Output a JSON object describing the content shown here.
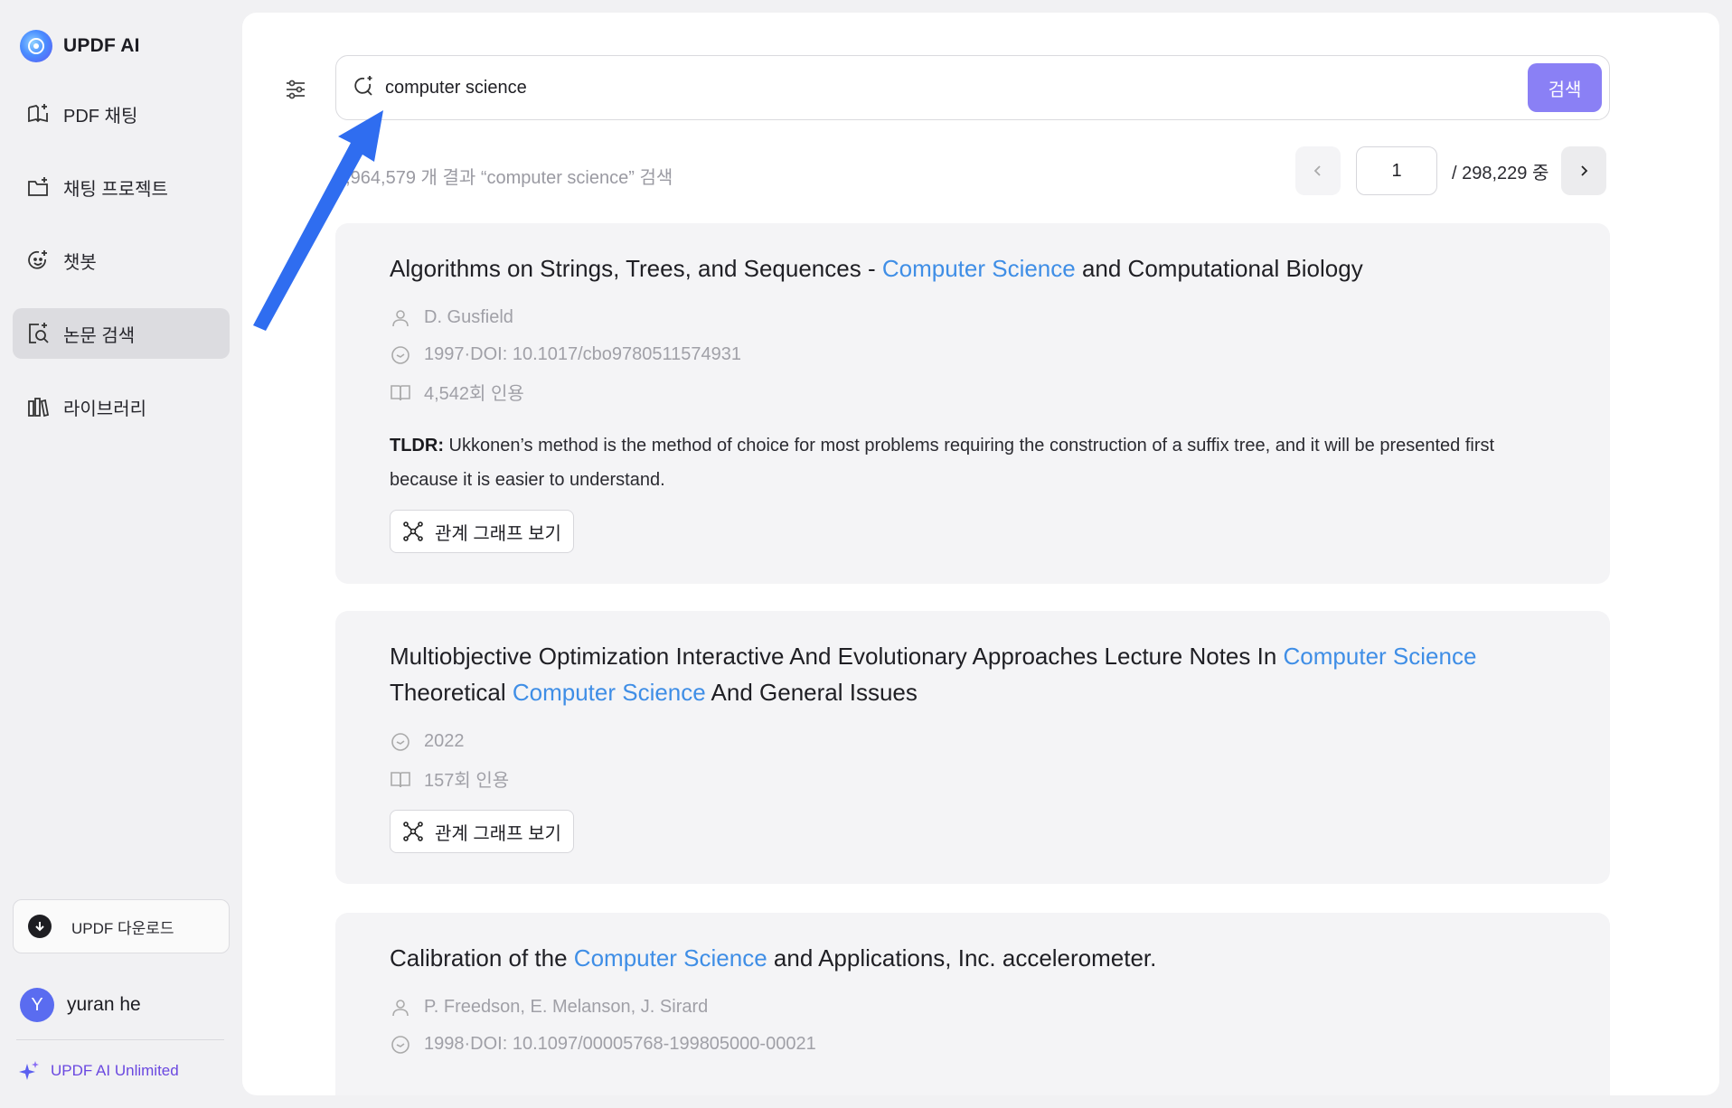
{
  "app": {
    "name": "UPDF AI"
  },
  "sidebar": {
    "items": [
      {
        "label": "PDF 채팅",
        "icon": "book-sparkle-icon",
        "active": false
      },
      {
        "label": "채팅 프로젝트",
        "icon": "folder-plus-icon",
        "active": false
      },
      {
        "label": "챗봇",
        "icon": "smile-bot-icon",
        "active": false
      },
      {
        "label": "논문 검색",
        "icon": "paper-search-icon",
        "active": true
      },
      {
        "label": "라이브러리",
        "icon": "library-icon",
        "active": false
      }
    ],
    "download_label": "UPDF 다운로드",
    "user": {
      "initial": "Y",
      "name": "yuran he"
    },
    "plan_label": "UPDF AI Unlimited"
  },
  "search": {
    "query": "computer science",
    "button_label": "검색"
  },
  "results": {
    "count_text": "5,964,579 개 결과 “computer science” 검색",
    "page": "1",
    "total_text": "/ 298,229 중"
  },
  "papers": [
    {
      "title_parts": [
        "Algorithms on Strings, Trees, and Sequences - ",
        "Computer Science",
        " and Computational Biology"
      ],
      "authors": [
        "D. Gusfield"
      ],
      "date": "1997·DOI: 10.1017/cbo9780511574931",
      "citations": "4,542회 인용",
      "tldr_label": "TLDR:",
      "tldr": " Ukkonen’s method is the method of choice for most problems requiring the construction of a suffix tree, and it will be presented first because it is easier to understand.",
      "graph_label": "관계 그래프 보기"
    },
    {
      "title_parts": [
        "Multiobjective Optimization Interactive And Evolutionary Approaches Lecture Notes In ",
        "Computer Science",
        " Theoretical ",
        "Computer Science",
        " And General Issues"
      ],
      "date": "2022",
      "citations": "157회 인용",
      "graph_label": "관계 그래프 보기"
    },
    {
      "title_parts": [
        "Calibration of the ",
        "Computer Science",
        " and Applications, Inc. accelerometer."
      ],
      "authors": [
        "P. Freedson",
        "E. Melanson",
        "J. Sirard"
      ],
      "date": "1998·DOI: 10.1097/00005768-199805000-00021"
    }
  ],
  "colors": {
    "accent": "#8a80f5",
    "highlight": "#3f8ee6",
    "annotation_arrow": "#2f6df0"
  }
}
